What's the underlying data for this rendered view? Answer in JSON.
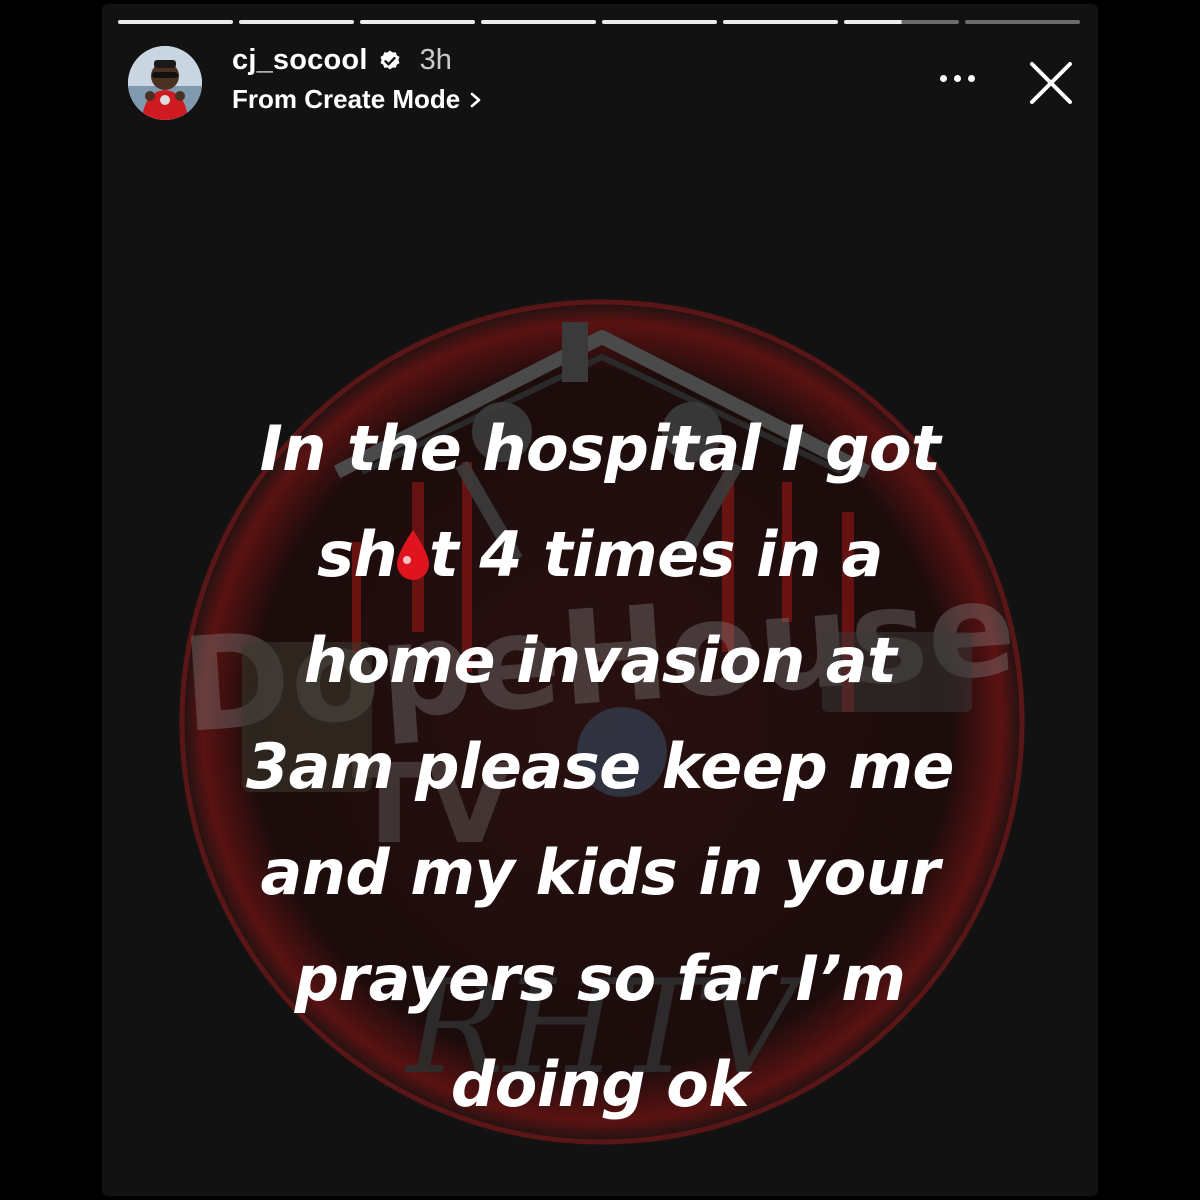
{
  "header": {
    "username": "cj_socool",
    "time_ago": "3h",
    "subtitle": "From Create Mode"
  },
  "progress": {
    "segments": 8,
    "completed": 6,
    "current_fraction": 0.5
  },
  "caption": {
    "lines": [
      "In the hospital I got",
      "sh",
      "t 4 times in a",
      "home invasion at",
      "3am please keep me",
      "and my kids in your",
      "prayers so far I’m",
      "doing ok"
    ]
  },
  "background_logo": {
    "text": "DopeHouse TV",
    "signature": "RHTV"
  },
  "icons": {
    "verified": "verified-badge-icon",
    "chevron": "chevron-right-icon",
    "more": "more-options-icon",
    "close": "close-icon",
    "emoji": "drop-of-blood-emoji"
  },
  "colors": {
    "background": "#121212",
    "accent_red": "#e0141e",
    "logo_red": "#7a1414"
  }
}
